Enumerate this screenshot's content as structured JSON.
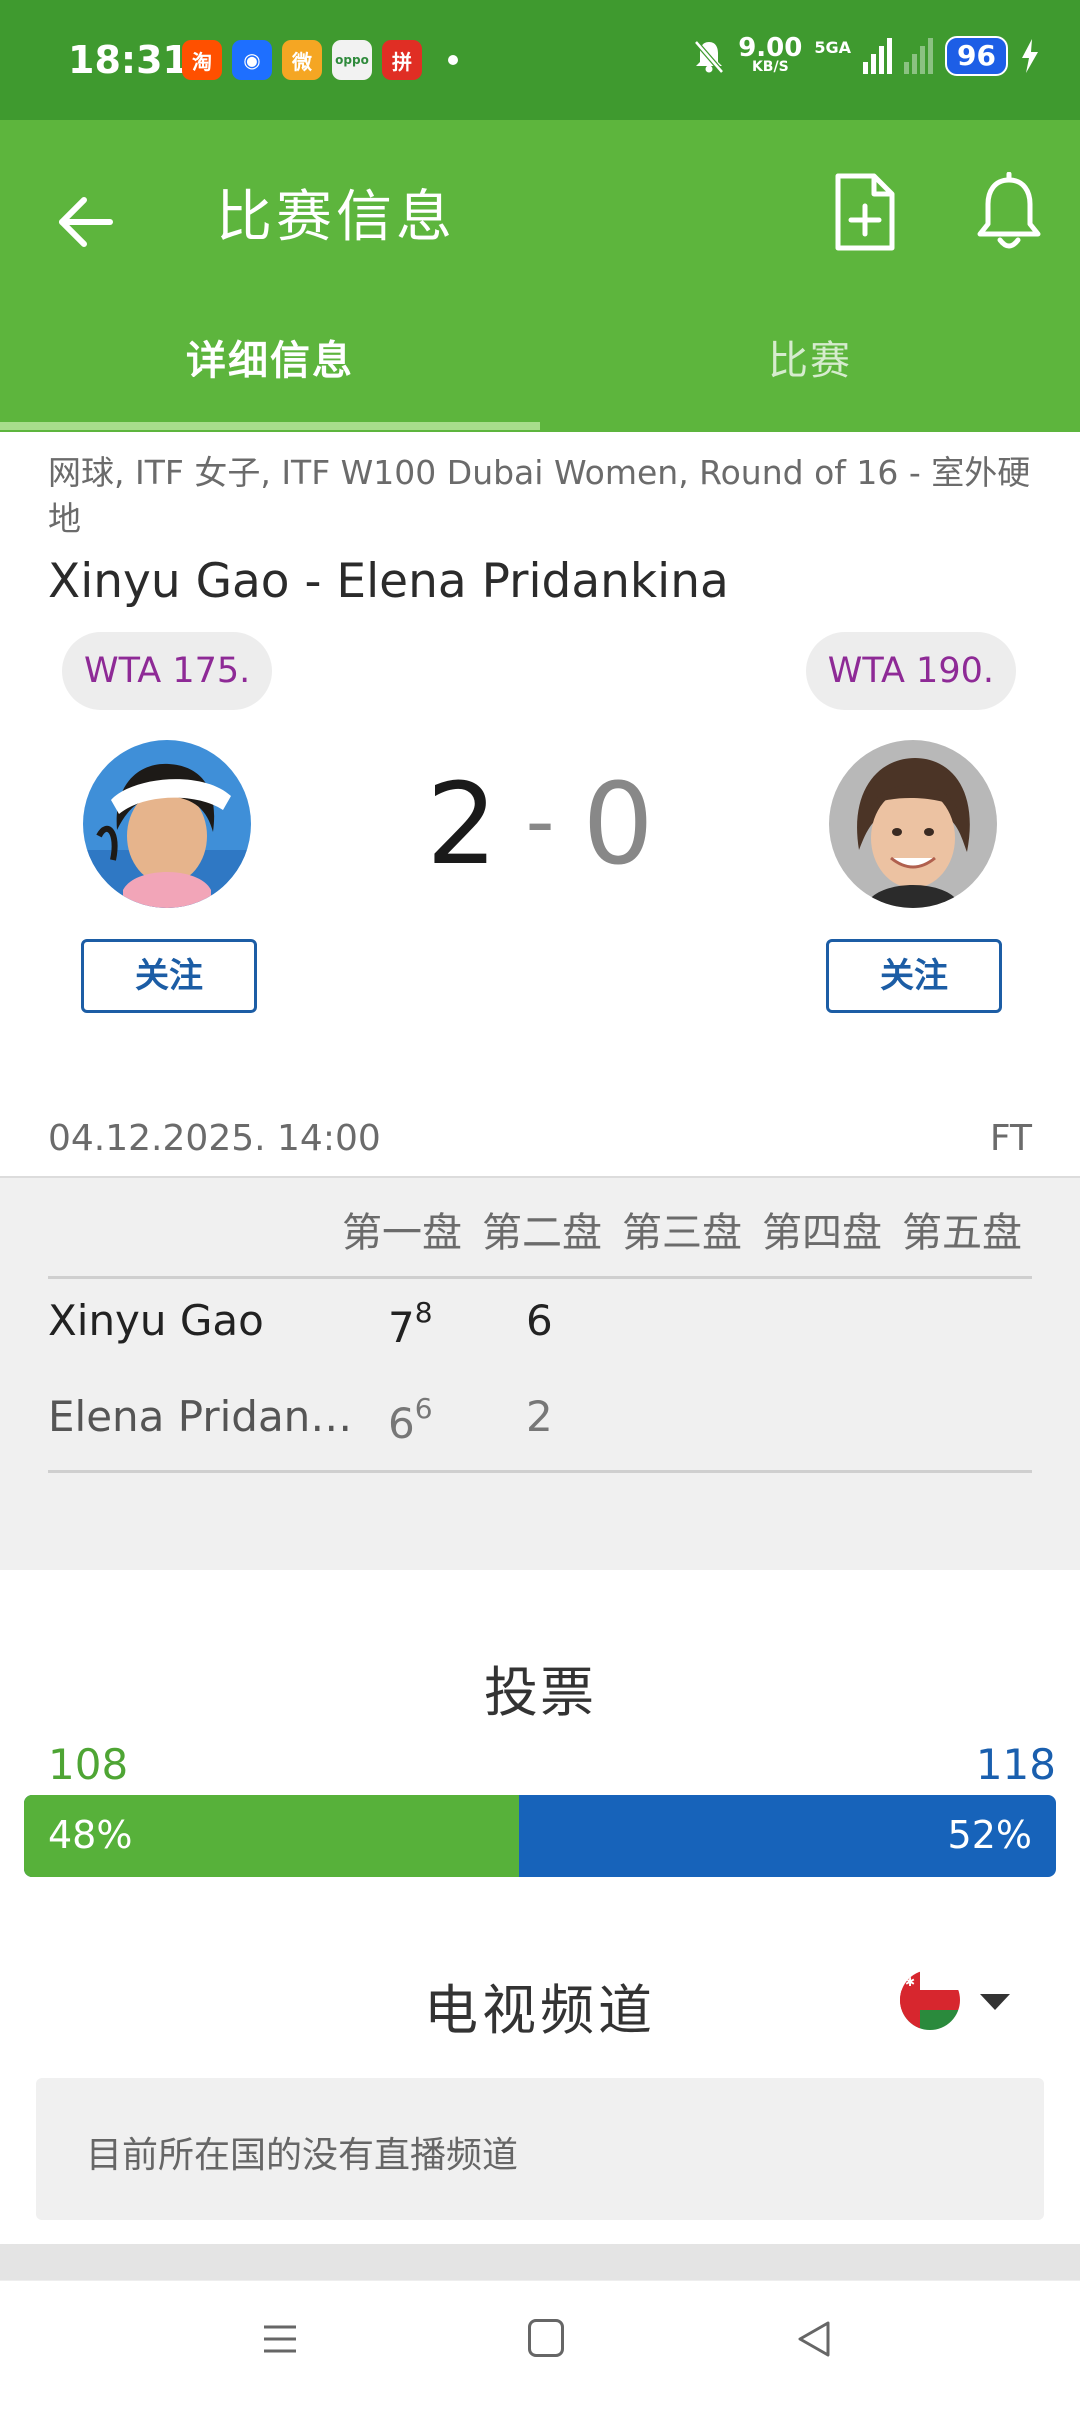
{
  "status_bar": {
    "time": "18:31",
    "apps": [
      {
        "name": "taobao-app-icon",
        "glyph": "淘",
        "color": "#ff5000"
      },
      {
        "name": "qq-browser-app-icon",
        "glyph": "◉",
        "color": "#1e6fff"
      },
      {
        "name": "weibo-app-icon",
        "glyph": "微",
        "color": "#f5a623"
      },
      {
        "name": "oppo-app-icon",
        "glyph": "oppo",
        "color": "#f2f2f2"
      },
      {
        "name": "pinduoduo-app-icon",
        "glyph": "拼",
        "color": "#e02e24"
      }
    ],
    "net_speed": "9.00",
    "net_unit": "KB/S",
    "net_type": "5GA",
    "battery": "96"
  },
  "app_bar": {
    "title": "比赛信息",
    "tabs": [
      {
        "label": "详细信息",
        "active": true
      },
      {
        "label": "比赛",
        "active": false
      }
    ]
  },
  "match": {
    "breadcrumb": "网球, ITF 女子, ITF W100 Dubai Women, Round of 16 - 室外硬地",
    "title": "Xinyu Gao - Elena Pridankina",
    "home": {
      "rank": "WTA 175.",
      "follow_label": "关注",
      "sets_won": "2"
    },
    "away": {
      "rank": "WTA 190.",
      "follow_label": "关注",
      "sets_won": "0"
    },
    "score_separator": "-",
    "date_time": "04.12.2025. 14:00",
    "status": "FT"
  },
  "scoreboard": {
    "set_headers": [
      "第一盘",
      "第二盘",
      "第三盘",
      "第四盘",
      "第五盘"
    ],
    "rows": [
      {
        "name": "Xinyu Gao",
        "set1": "7",
        "set1_tiebreak": "8",
        "set2": "6"
      },
      {
        "name": "Elena Pridan…",
        "set1": "6",
        "set1_tiebreak": "6",
        "set2": "2"
      }
    ]
  },
  "vote": {
    "title": "投票",
    "home_count": "108",
    "away_count": "118",
    "home_pct": "48%",
    "away_pct": "52%",
    "home_fraction": 0.48,
    "home_color": "#57b13a",
    "away_color": "#1763ba"
  },
  "tv": {
    "title": "电视频道",
    "country_flag": "oman-flag-icon",
    "message": "目前所在国的没有直播频道"
  },
  "colors": {
    "status_bar": "#3f9a2f",
    "app_bar": "#5db53d",
    "follow_accent": "#1c5da5",
    "rank_text": "#8e2a96"
  }
}
